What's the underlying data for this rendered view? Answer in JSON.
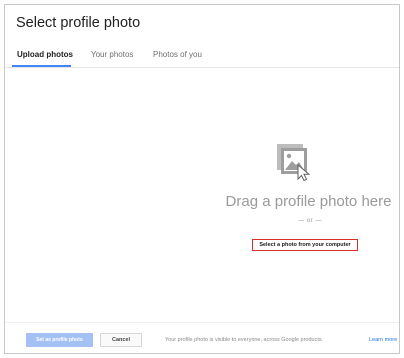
{
  "dialog": {
    "title": "Select profile photo"
  },
  "tabs": [
    {
      "label": "Upload photos",
      "active": true
    },
    {
      "label": "Your photos",
      "active": false
    },
    {
      "label": "Photos of you",
      "active": false
    }
  ],
  "upload": {
    "icon": "photo-upload-icon",
    "drag_text": "Drag a profile photo here",
    "or_text": "— or —",
    "select_link": "Select a photo from your computer"
  },
  "footer": {
    "set_button": "Set as profile photo",
    "cancel_button": "Cancel",
    "note": "Your profile photo is visible to everyone, across Google products.",
    "learn_more": "Learn more"
  },
  "colors": {
    "accent": "#4285f4",
    "highlight_border": "#d93025",
    "disabled_button": "#a4c1f5"
  }
}
